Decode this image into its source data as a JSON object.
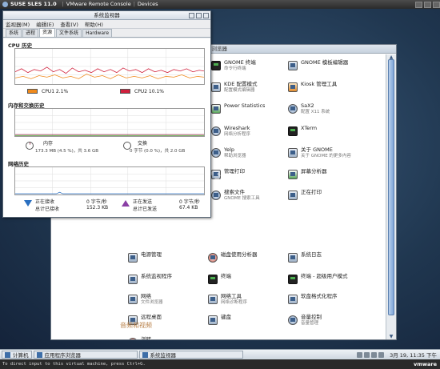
{
  "vmware_bar": {
    "os": "SUSE SLES 11.0",
    "console": "VMware Remote Console",
    "devices": "Devices"
  },
  "app_browser": {
    "title": "序浏览器",
    "apps": [
      {
        "name": "GNOME 终端",
        "desc": "命令行终端"
      },
      {
        "name": "GNOME 模板编辑器",
        "desc": ""
      },
      {
        "name": "KDE 配置模式",
        "desc": "配置模式编辑器"
      },
      {
        "name": "Kiosk 管理工具",
        "desc": ""
      },
      {
        "name": "Power Statistics",
        "desc": ""
      },
      {
        "name": "SaX2",
        "desc": "配置 X11 系统"
      },
      {
        "name": "Wireshark",
        "desc": "网络分析程序"
      },
      {
        "name": "XTerm",
        "desc": ""
      },
      {
        "name": "Yelp",
        "desc": "帮助浏览器"
      },
      {
        "name": "关于 GNOME",
        "desc": "关于 GNOME 的更多内容"
      },
      {
        "name": "管理打印",
        "desc": ""
      },
      {
        "name": "屏幕分析器",
        "desc": ""
      },
      {
        "name": "搜索文件",
        "desc": "GNOME 搜索工具"
      },
      {
        "name": "正在打印",
        "desc": ""
      },
      {
        "name": "电源管理",
        "desc": ""
      },
      {
        "name": "磁盘使用分析器",
        "desc": ""
      },
      {
        "name": "系统日志",
        "desc": ""
      },
      {
        "name": "系统监视程序",
        "desc": ""
      },
      {
        "name": "终端",
        "desc": ""
      },
      {
        "name": "终端 - 超级用户模式",
        "desc": ""
      },
      {
        "name": "网络",
        "desc": "文件浏览器"
      },
      {
        "name": "网络工具",
        "desc": "网络诊断程序"
      },
      {
        "name": "软盘格式化程序",
        "desc": ""
      },
      {
        "name": "远程桌面",
        "desc": ""
      },
      {
        "name": "键盘",
        "desc": ""
      },
      {
        "name": "音量控制",
        "desc": "音量管理"
      },
      {
        "name": "浏转",
        "desc": ""
      }
    ],
    "section_audio_video": "音频和视频"
  },
  "system_monitor": {
    "title": "系统监视器",
    "menu": [
      "监视器(M)",
      "编辑(E)",
      "查看(V)",
      "帮助(H)"
    ],
    "tabs": [
      "系统",
      "进程",
      "资源",
      "文件系统",
      "Hardware"
    ],
    "active_tab": "资源",
    "cpu": {
      "heading": "CPU 历史",
      "cpu1_label": "CPU1 2.1%",
      "cpu2_label": "CPU2 10.1%",
      "cpu1_color": "#f08a1c",
      "cpu2_color": "#d0203c"
    },
    "memory": {
      "heading": "内存和交换历史",
      "mem_title": "内存",
      "mem_value": "173.3 MB (4.5 %)，共 3.6 GB",
      "swap_title": "交换",
      "swap_value": "0 字节 (0.0 %)，共 2.0 GB",
      "mem_color": "#8a1f3a",
      "swap_color": "#4ea93a"
    },
    "network": {
      "heading": "网络历史",
      "recv_title": "正在接收",
      "recv_rate": "0 字节/秒",
      "recv_total_label": "总计已接收",
      "recv_total": "152.3 KB",
      "send_title": "正在发送",
      "send_rate": "0 字节/秒",
      "send_total_label": "总计已发送",
      "send_total": "67.4 KB",
      "recv_color": "#2a6fc0",
      "send_color": "#8a3fa5"
    }
  },
  "watermark": {
    "text": "IT168",
    "cn": "评测中心"
  },
  "taskbar": {
    "items": [
      "计算机",
      "应用程序浏览器",
      "系统监视器"
    ],
    "clock": "3月 19, 11:35 下午"
  },
  "statusbar": {
    "text": "To direct input to this virtual machine, press Ctrl+G.",
    "brand": "vmware"
  }
}
